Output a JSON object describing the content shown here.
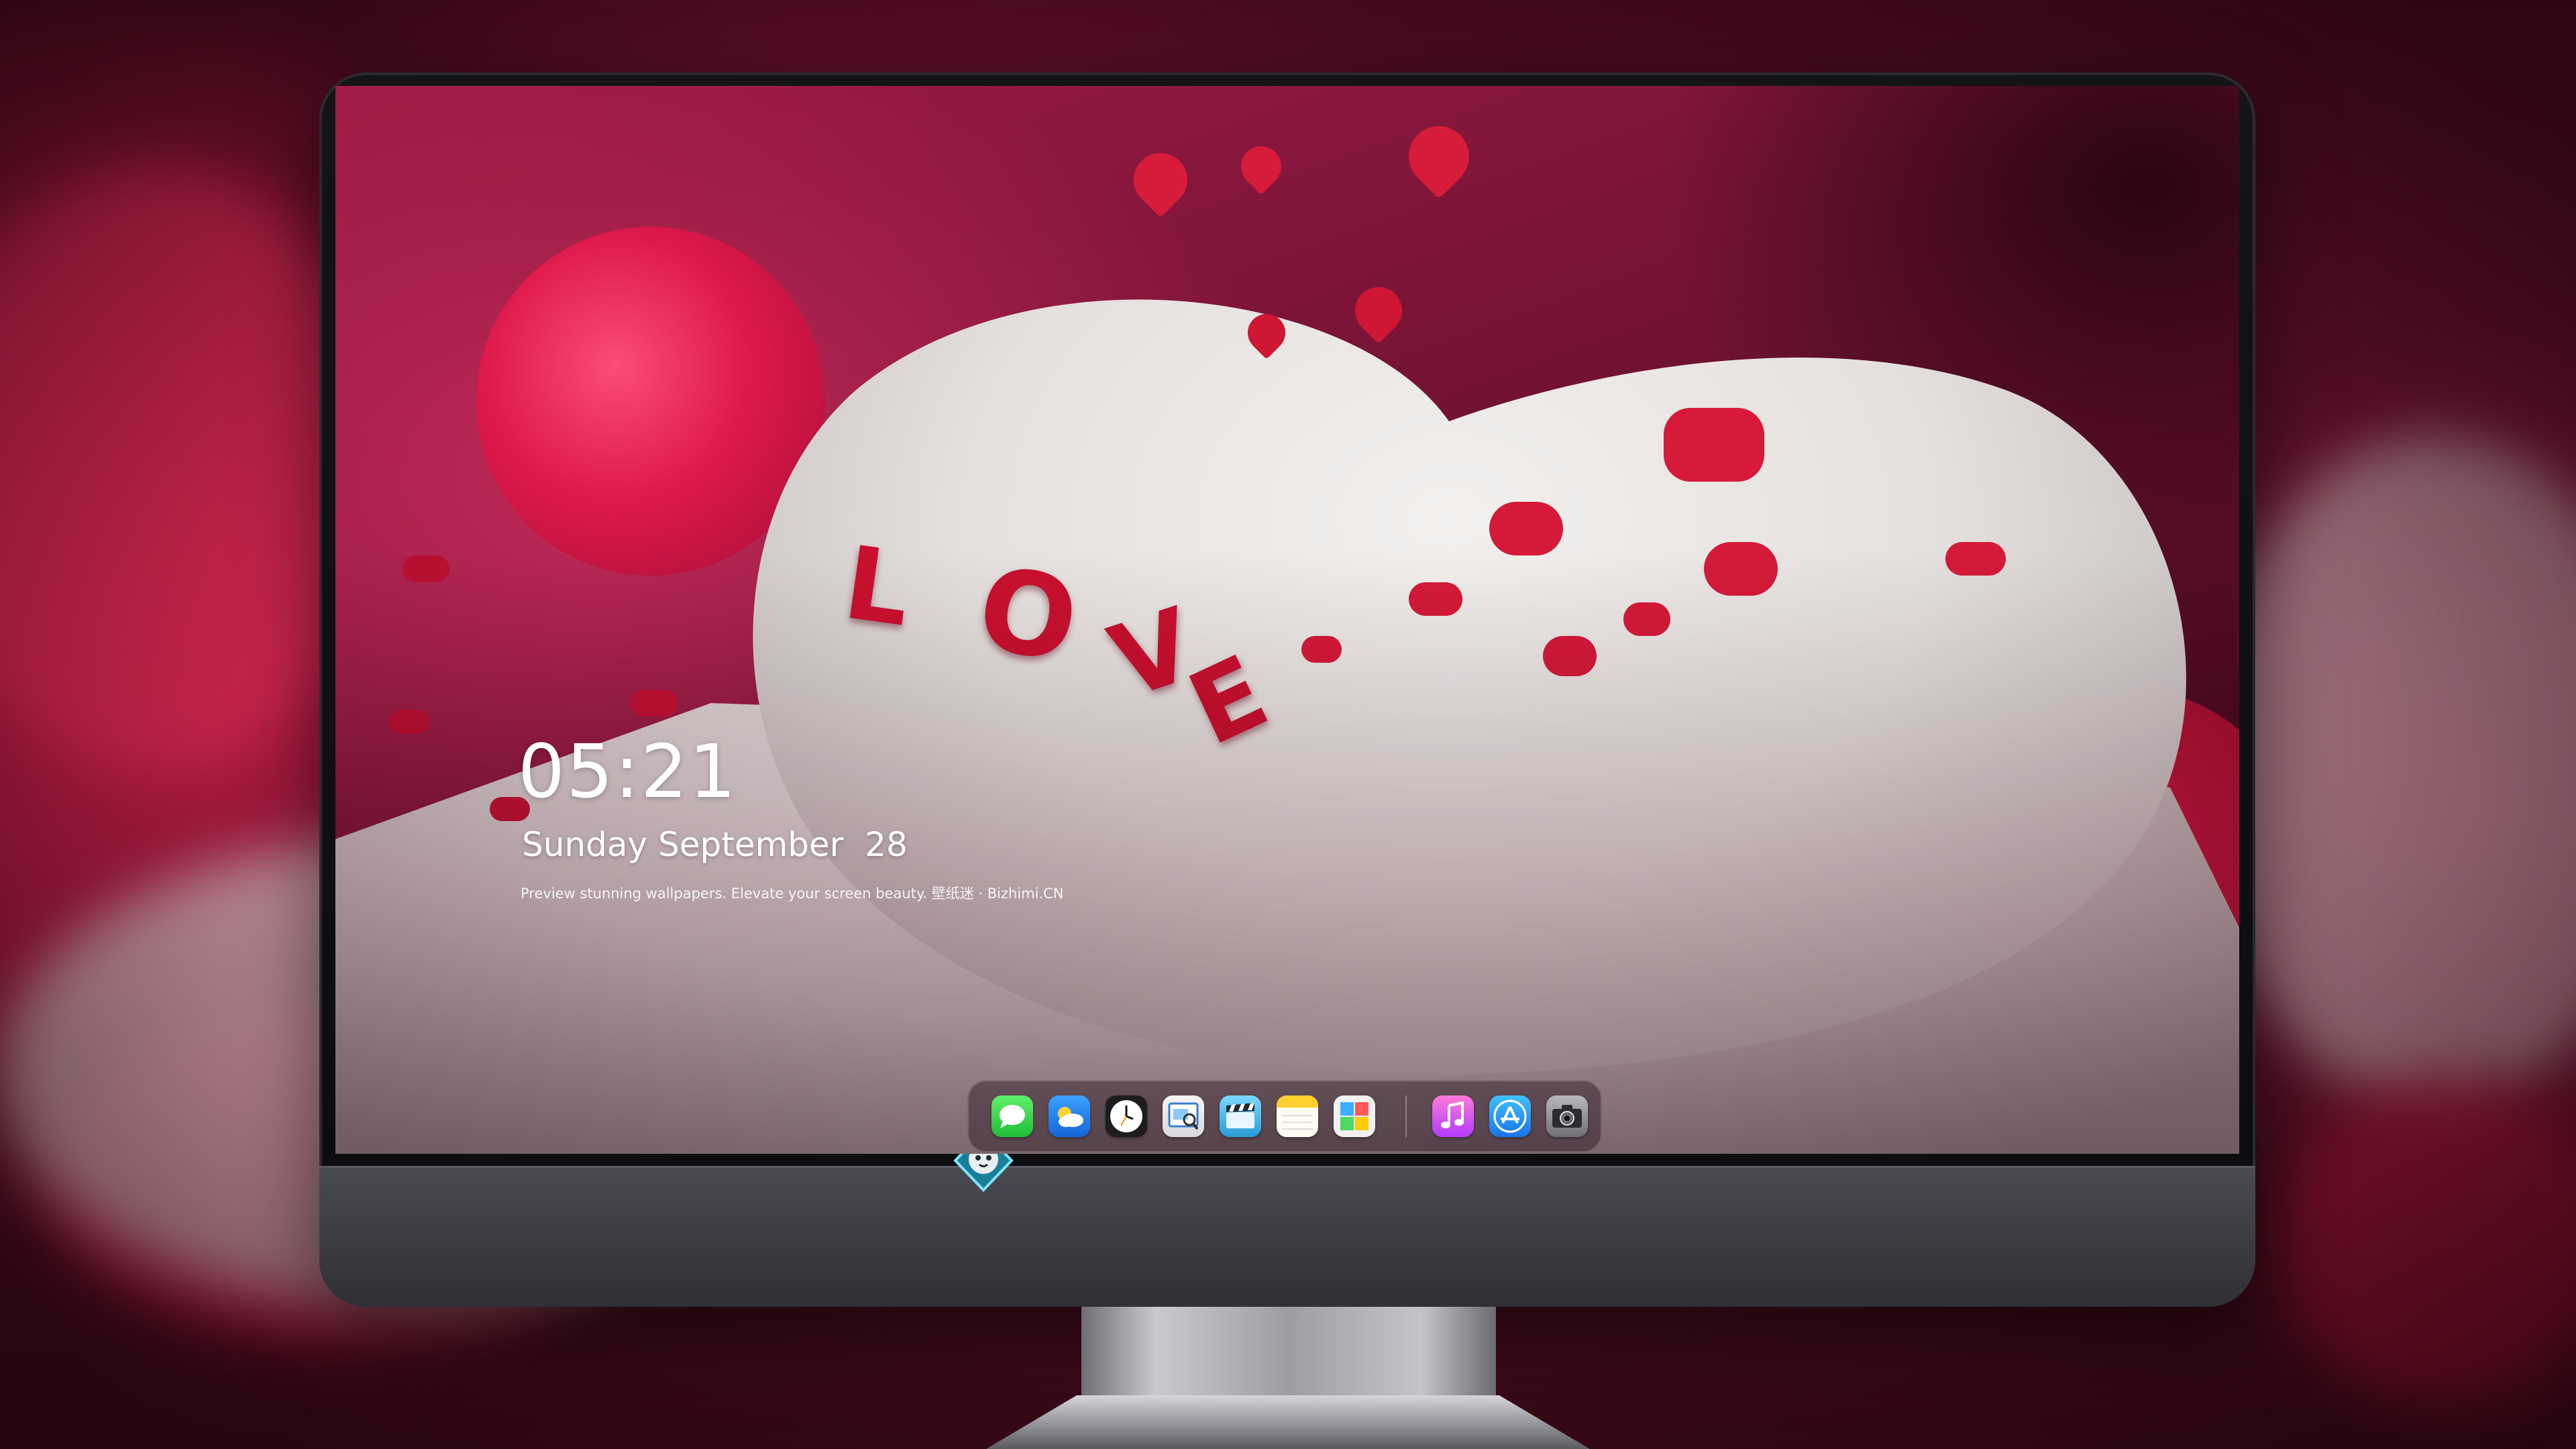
{
  "lock_screen": {
    "time": "05:21",
    "date": "Sunday September  28",
    "tagline": "Preview stunning wallpapers. Elevate your screen beauty. 壁纸迷 · Bizhimi.CN"
  },
  "wallpaper": {
    "cake_letters": [
      "L",
      "O",
      "V",
      "E"
    ]
  },
  "dock": {
    "apps": [
      {
        "name": "Messages",
        "icon": "messages-icon"
      },
      {
        "name": "Weather",
        "icon": "weather-icon"
      },
      {
        "name": "Clock",
        "icon": "clock-icon"
      },
      {
        "name": "Preview",
        "icon": "preview-icon"
      },
      {
        "name": "Clips",
        "icon": "clapper-icon"
      },
      {
        "name": "Notes",
        "icon": "notes-icon"
      },
      {
        "name": "Photo Booth",
        "icon": "photo-booth-icon"
      },
      {
        "name": "Music",
        "icon": "music-icon"
      },
      {
        "name": "App Store",
        "icon": "app-store-icon"
      },
      {
        "name": "Camera",
        "icon": "camera-icon"
      }
    ]
  },
  "colors": {
    "accent_red": "#c8102e",
    "screen_bezel": "#0c0c0e",
    "chin": "#3b3b42"
  }
}
